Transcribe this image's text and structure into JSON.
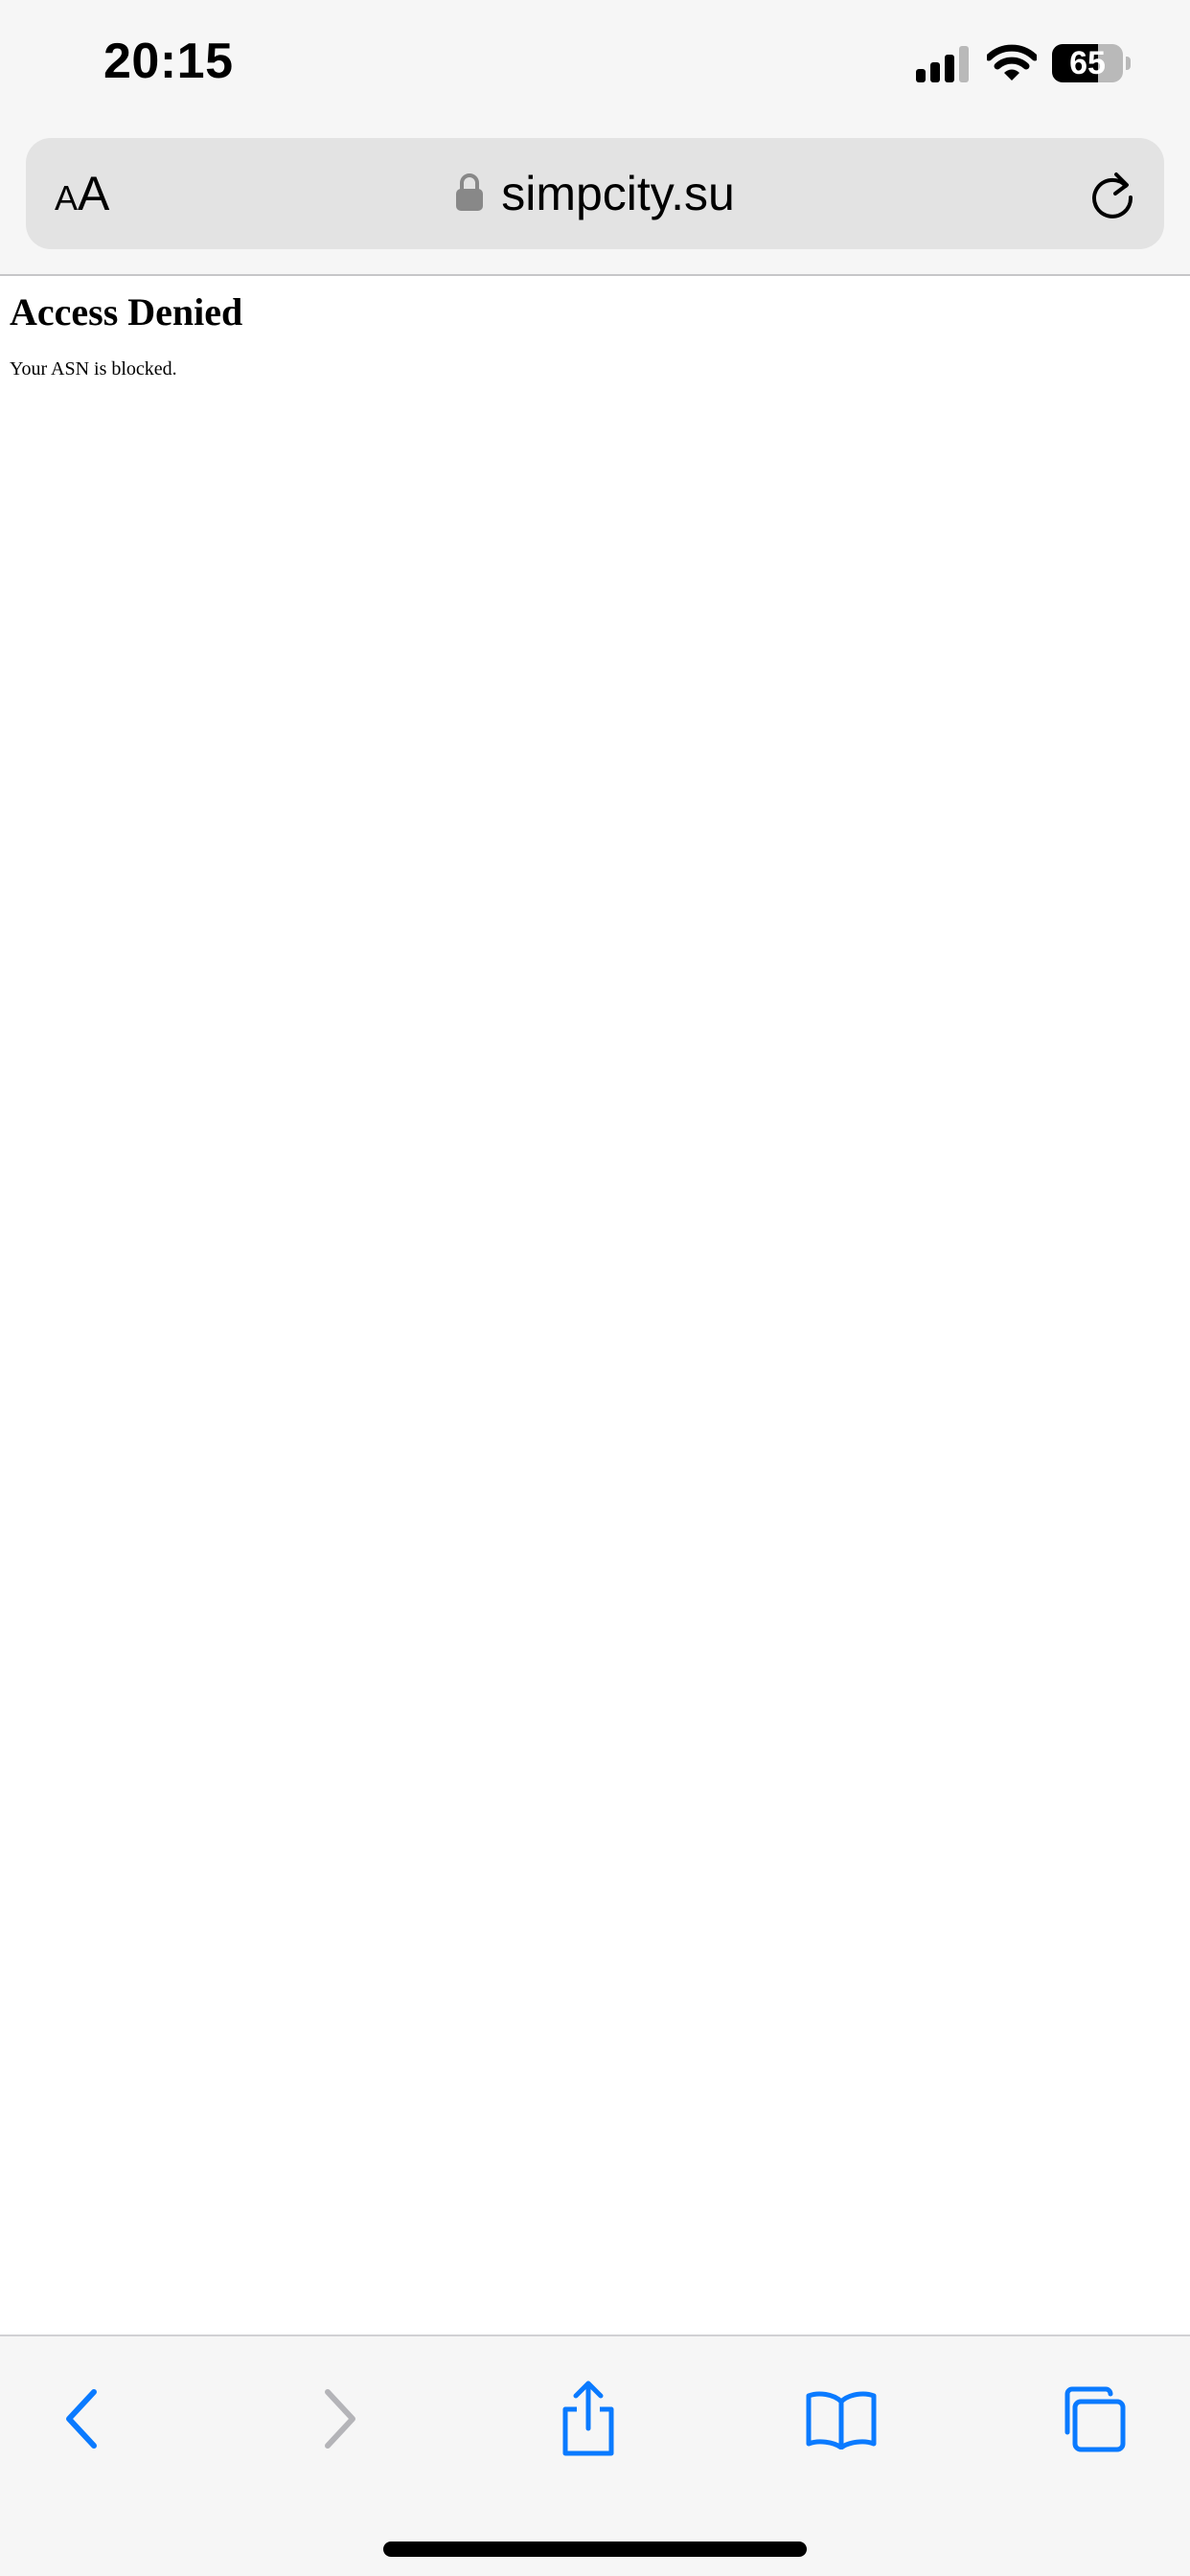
{
  "status_bar": {
    "time": "20:15",
    "battery_level": "65",
    "icons": [
      "signal-icon",
      "wifi-icon",
      "battery-icon"
    ]
  },
  "address_bar": {
    "reader_small": "A",
    "reader_big": "A",
    "url": "simpcity.su",
    "icons": [
      "lock-icon",
      "reload-icon"
    ]
  },
  "page": {
    "heading": "Access Denied",
    "message": "Your ASN is blocked."
  },
  "bottom_toolbar": {
    "buttons": [
      "back-icon",
      "forward-icon",
      "share-icon",
      "bookmarks-icon",
      "tabs-icon"
    ],
    "accent_color": "#0a7aff",
    "disabled_color": "#b4b4b8"
  }
}
